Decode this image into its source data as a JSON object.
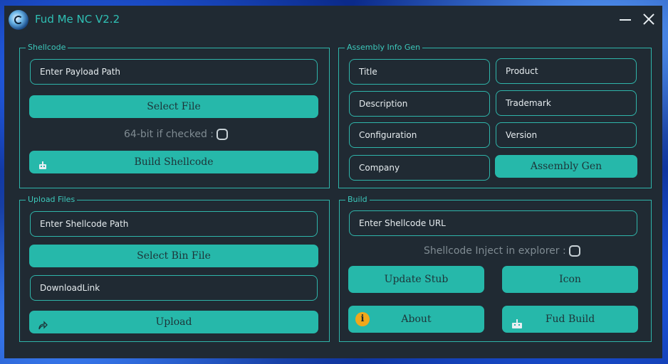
{
  "window": {
    "title": "Fud Me NC V2.2",
    "accent": "#26b8aa",
    "background": "#202a33"
  },
  "shellcode": {
    "label": "Shellcode",
    "payload_placeholder": "Enter Payload Path",
    "select_file": "Select File",
    "checkbox_label": "64-bit if checked :",
    "build": "Build Shellcode"
  },
  "assembly": {
    "label": "Assembly Info Gen",
    "fields": {
      "title": "Title",
      "product": "Product",
      "description": "Description",
      "trademark": "Trademark",
      "configuration": "Configuration",
      "version": "Version",
      "company": "Company"
    },
    "gen_button": "Assembly Gen"
  },
  "upload": {
    "label": "Upload Files",
    "shellcode_path_placeholder": "Enter Shellcode Path",
    "select_bin": "Select Bin File",
    "download_link_placeholder": "DownloadLink",
    "upload_button": "Upload"
  },
  "build": {
    "label": "Build",
    "url_placeholder": "Enter Shellcode URL",
    "inject_label": "Shellcode Inject in explorer :",
    "update_stub": "Update Stub",
    "icon": "Icon",
    "about": "About",
    "fud_build": "Fud Build"
  },
  "icons": {
    "app": "app-logo-icon",
    "build_shellcode": "robot-icon",
    "upload": "share-arrow-icon",
    "about": "info-icon",
    "fud_build": "robot-icon"
  }
}
